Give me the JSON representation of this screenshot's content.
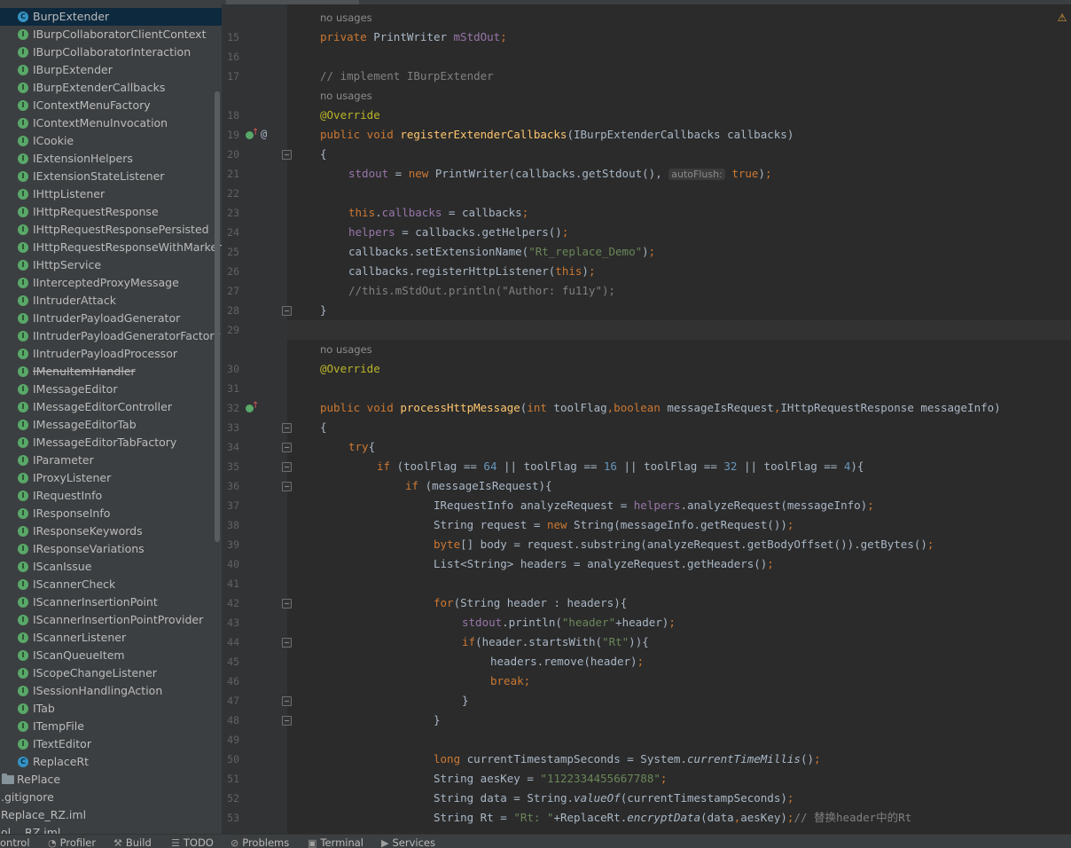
{
  "sidebar": {
    "items": [
      {
        "label": "BurpExtender",
        "kind": "class",
        "selected": true,
        "strike": false
      },
      {
        "label": "IBurpCollaboratorClientContext",
        "kind": "interface"
      },
      {
        "label": "IBurpCollaboratorInteraction",
        "kind": "interface"
      },
      {
        "label": "IBurpExtender",
        "kind": "interface"
      },
      {
        "label": "IBurpExtenderCallbacks",
        "kind": "interface"
      },
      {
        "label": "IContextMenuFactory",
        "kind": "interface"
      },
      {
        "label": "IContextMenuInvocation",
        "kind": "interface"
      },
      {
        "label": "ICookie",
        "kind": "interface"
      },
      {
        "label": "IExtensionHelpers",
        "kind": "interface"
      },
      {
        "label": "IExtensionStateListener",
        "kind": "interface"
      },
      {
        "label": "IHttpListener",
        "kind": "interface"
      },
      {
        "label": "IHttpRequestResponse",
        "kind": "interface"
      },
      {
        "label": "IHttpRequestResponsePersisted",
        "kind": "interface"
      },
      {
        "label": "IHttpRequestResponseWithMarkers",
        "kind": "interface"
      },
      {
        "label": "IHttpService",
        "kind": "interface"
      },
      {
        "label": "IInterceptedProxyMessage",
        "kind": "interface"
      },
      {
        "label": "IIntruderAttack",
        "kind": "interface"
      },
      {
        "label": "IIntruderPayloadGenerator",
        "kind": "interface"
      },
      {
        "label": "IIntruderPayloadGeneratorFactory",
        "kind": "interface"
      },
      {
        "label": "IIntruderPayloadProcessor",
        "kind": "interface"
      },
      {
        "label": "IMenuItemHandler",
        "kind": "interface",
        "strike": true
      },
      {
        "label": "IMessageEditor",
        "kind": "interface"
      },
      {
        "label": "IMessageEditorController",
        "kind": "interface"
      },
      {
        "label": "IMessageEditorTab",
        "kind": "interface"
      },
      {
        "label": "IMessageEditorTabFactory",
        "kind": "interface"
      },
      {
        "label": "IParameter",
        "kind": "interface"
      },
      {
        "label": "IProxyListener",
        "kind": "interface"
      },
      {
        "label": "IRequestInfo",
        "kind": "interface"
      },
      {
        "label": "IResponseInfo",
        "kind": "interface"
      },
      {
        "label": "IResponseKeywords",
        "kind": "interface"
      },
      {
        "label": "IResponseVariations",
        "kind": "interface"
      },
      {
        "label": "IScanIssue",
        "kind": "interface"
      },
      {
        "label": "IScannerCheck",
        "kind": "interface"
      },
      {
        "label": "IScannerInsertionPoint",
        "kind": "interface"
      },
      {
        "label": "IScannerInsertionPointProvider",
        "kind": "interface"
      },
      {
        "label": "IScannerListener",
        "kind": "interface"
      },
      {
        "label": "IScanQueueItem",
        "kind": "interface"
      },
      {
        "label": "IScopeChangeListener",
        "kind": "interface"
      },
      {
        "label": "ISessionHandlingAction",
        "kind": "interface"
      },
      {
        "label": "ITab",
        "kind": "interface"
      },
      {
        "label": "ITempFile",
        "kind": "interface"
      },
      {
        "label": "ITextEditor",
        "kind": "interface"
      },
      {
        "label": "ReplaceRt",
        "kind": "class"
      },
      {
        "label": "RePlace",
        "kind": "folder"
      },
      {
        "label": ".gitignore",
        "kind": "file"
      },
      {
        "label": "Replace_RZ.iml",
        "kind": "file"
      },
      {
        "label": "ol... RZ.iml",
        "kind": "file"
      }
    ]
  },
  "editor": {
    "no_usages_label": "no usages",
    "lines": [
      {
        "type": "nousage"
      },
      {
        "n": "15",
        "indent": 0,
        "parts": [
          [
            "kw",
            "private "
          ],
          [
            "",
            "PrintWriter "
          ],
          [
            "fld",
            "mStdOut"
          ],
          [
            "kw",
            ";"
          ]
        ]
      },
      {
        "n": "16",
        "indent": 0,
        "parts": []
      },
      {
        "n": "17",
        "indent": 0,
        "parts": [
          [
            "cmt",
            "// implement IBurpExtender"
          ]
        ]
      },
      {
        "type": "nousage"
      },
      {
        "n": "18",
        "indent": 0,
        "parts": [
          [
            "ann",
            "@Override"
          ]
        ]
      },
      {
        "n": "19",
        "indent": 0,
        "gutter": "impl-at",
        "parts": [
          [
            "kw",
            "public void "
          ],
          [
            "fn",
            "registerExtenderCallbacks"
          ],
          [
            "",
            "(IBurpExtenderCallbacks callbacks)"
          ]
        ]
      },
      {
        "n": "20",
        "indent": 0,
        "fold": true,
        "parts": [
          [
            "",
            "{"
          ]
        ]
      },
      {
        "n": "21",
        "indent": 1,
        "parts": [
          [
            "fld",
            "stdout"
          ],
          [
            "",
            " = "
          ],
          [
            "kw",
            "new "
          ],
          [
            "",
            "PrintWriter(callbacks.getStdout(), "
          ],
          [
            "hint",
            "autoFlush:"
          ],
          [
            "",
            " "
          ],
          [
            "kw",
            "true"
          ],
          [
            "",
            ")"
          ],
          [
            "kw",
            ";"
          ]
        ]
      },
      {
        "n": "22",
        "indent": 0,
        "parts": []
      },
      {
        "n": "23",
        "indent": 1,
        "parts": [
          [
            "kw",
            "this"
          ],
          [
            "",
            "."
          ],
          [
            "fld",
            "callbacks"
          ],
          [
            "",
            " = callbacks"
          ],
          [
            "kw",
            ";"
          ]
        ]
      },
      {
        "n": "24",
        "indent": 1,
        "parts": [
          [
            "fld",
            "helpers"
          ],
          [
            "",
            " = callbacks.getHelpers()"
          ],
          [
            "kw",
            ";"
          ]
        ]
      },
      {
        "n": "25",
        "indent": 1,
        "parts": [
          [
            "",
            "callbacks.setExtensionName("
          ],
          [
            "str",
            "\"Rt_replace_Demo\""
          ],
          [
            "",
            ")"
          ],
          [
            "kw",
            ";"
          ]
        ]
      },
      {
        "n": "26",
        "indent": 1,
        "parts": [
          [
            "",
            "callbacks.registerHttpListener("
          ],
          [
            "kw",
            "this"
          ],
          [
            "",
            ")"
          ],
          [
            "kw",
            ";"
          ]
        ]
      },
      {
        "n": "27",
        "indent": 1,
        "parts": [
          [
            "cmt",
            "//this.mStdOut.println(\"Author: fu11y\");"
          ]
        ]
      },
      {
        "n": "28",
        "indent": 0,
        "fold": true,
        "parts": [
          [
            "",
            "}"
          ]
        ]
      },
      {
        "n": "29",
        "indent": 0,
        "current": true,
        "parts": []
      },
      {
        "type": "nousage"
      },
      {
        "n": "30",
        "indent": 0,
        "parts": [
          [
            "ann",
            "@Override"
          ]
        ]
      },
      {
        "n": "31",
        "indent": 0,
        "parts": []
      },
      {
        "n": "32",
        "indent": 0,
        "gutter": "impl",
        "parts": [
          [
            "kw",
            "public void "
          ],
          [
            "fn",
            "processHttpMessage"
          ],
          [
            "",
            "("
          ],
          [
            "kw",
            "int "
          ],
          [
            "",
            "toolFlag"
          ],
          [
            "kw",
            ","
          ],
          [
            "kw",
            "boolean "
          ],
          [
            "",
            "messageIsRequest"
          ],
          [
            "kw",
            ","
          ],
          [
            "",
            "IHttpRequestResponse messageInfo)"
          ]
        ]
      },
      {
        "n": "33",
        "indent": 0,
        "fold": true,
        "parts": [
          [
            "",
            "{"
          ]
        ]
      },
      {
        "n": "34",
        "indent": 1,
        "fold": true,
        "parts": [
          [
            "kw",
            "try"
          ],
          [
            "",
            "{"
          ]
        ]
      },
      {
        "n": "35",
        "indent": 2,
        "fold": true,
        "parts": [
          [
            "kw",
            "if "
          ],
          [
            "",
            "(toolFlag == "
          ],
          [
            "num",
            "64"
          ],
          [
            "",
            " || toolFlag == "
          ],
          [
            "num",
            "16"
          ],
          [
            "",
            " || toolFlag == "
          ],
          [
            "num",
            "32"
          ],
          [
            "",
            " || toolFlag == "
          ],
          [
            "num",
            "4"
          ],
          [
            "",
            "){"
          ]
        ]
      },
      {
        "n": "36",
        "indent": 3,
        "fold": true,
        "parts": [
          [
            "kw",
            "if "
          ],
          [
            "",
            "(messageIsRequest){"
          ]
        ]
      },
      {
        "n": "37",
        "indent": 4,
        "parts": [
          [
            "",
            "IRequestInfo analyzeRequest = "
          ],
          [
            "fld",
            "helpers"
          ],
          [
            "",
            ".analyzeRequest(messageInfo)"
          ],
          [
            "kw",
            ";"
          ]
        ]
      },
      {
        "n": "38",
        "indent": 4,
        "parts": [
          [
            "",
            "String request = "
          ],
          [
            "kw",
            "new "
          ],
          [
            "",
            "String(messageInfo.getRequest())"
          ],
          [
            "kw",
            ";"
          ]
        ]
      },
      {
        "n": "39",
        "indent": 4,
        "parts": [
          [
            "kw",
            "byte"
          ],
          [
            "",
            "[] body = request.substring(analyzeRequest.getBodyOffset()).getBytes()"
          ],
          [
            "kw",
            ";"
          ]
        ]
      },
      {
        "n": "40",
        "indent": 4,
        "parts": [
          [
            "",
            "List<String> headers = analyzeRequest.getHeaders()"
          ],
          [
            "kw",
            ";"
          ]
        ]
      },
      {
        "n": "41",
        "indent": 0,
        "parts": []
      },
      {
        "n": "42",
        "indent": 4,
        "fold": true,
        "parts": [
          [
            "kw",
            "for"
          ],
          [
            "",
            "(String header : headers){"
          ]
        ]
      },
      {
        "n": "43",
        "indent": 5,
        "parts": [
          [
            "fld",
            "stdout"
          ],
          [
            "",
            ".println("
          ],
          [
            "str",
            "\"header\""
          ],
          [
            "",
            "+header)"
          ],
          [
            "kw",
            ";"
          ]
        ]
      },
      {
        "n": "44",
        "indent": 5,
        "fold": true,
        "parts": [
          [
            "kw",
            "if"
          ],
          [
            "",
            "(header.startsWith("
          ],
          [
            "str",
            "\"Rt\""
          ],
          [
            "",
            "))"
          ],
          [
            "",
            "{"
          ]
        ]
      },
      {
        "n": "45",
        "indent": 6,
        "parts": [
          [
            "",
            "headers.remove(header)"
          ],
          [
            "kw",
            ";"
          ]
        ]
      },
      {
        "n": "46",
        "indent": 6,
        "parts": [
          [
            "kw",
            "break;"
          ]
        ]
      },
      {
        "n": "47",
        "indent": 5,
        "fold": true,
        "parts": [
          [
            "",
            "}"
          ]
        ]
      },
      {
        "n": "48",
        "indent": 4,
        "fold": true,
        "parts": [
          [
            "",
            "}"
          ]
        ]
      },
      {
        "n": "49",
        "indent": 0,
        "parts": []
      },
      {
        "n": "50",
        "indent": 4,
        "parts": [
          [
            "kw",
            "long "
          ],
          [
            "",
            "currentTimestampSeconds = System."
          ],
          [
            "it",
            "currentTimeMillis"
          ],
          [
            "",
            "()"
          ],
          [
            "kw",
            ";"
          ]
        ]
      },
      {
        "n": "51",
        "indent": 4,
        "parts": [
          [
            "",
            "String aesKey = "
          ],
          [
            "str",
            "\"1122334455667788\""
          ],
          [
            "kw",
            ";"
          ]
        ]
      },
      {
        "n": "52",
        "indent": 4,
        "parts": [
          [
            "",
            "String data = String."
          ],
          [
            "it",
            "valueOf"
          ],
          [
            "",
            "(currentTimestampSeconds)"
          ],
          [
            "kw",
            ";"
          ]
        ]
      },
      {
        "n": "53",
        "indent": 4,
        "parts": [
          [
            "",
            "String Rt = "
          ],
          [
            "str",
            "\"Rt: \""
          ],
          [
            "",
            "+ReplaceRt."
          ],
          [
            "it",
            "encryptData"
          ],
          [
            "",
            "(data"
          ],
          [
            "kw",
            ","
          ],
          [
            "",
            "aesKey)"
          ],
          [
            "kw",
            ";"
          ],
          [
            "cmt",
            "// 替换header中的Rt"
          ]
        ]
      }
    ]
  },
  "bottom_bar": {
    "tabs": [
      {
        "label": "ontrol",
        "icon": ""
      },
      {
        "label": "Profiler",
        "icon": "profiler-icon"
      },
      {
        "label": "Build",
        "icon": "build-icon"
      },
      {
        "label": "TODO",
        "icon": "todo-icon"
      },
      {
        "label": "Problems",
        "icon": "problems-icon"
      },
      {
        "label": "Terminal",
        "icon": "terminal-icon"
      },
      {
        "label": "Services",
        "icon": "services-icon"
      }
    ]
  },
  "colors": {
    "keyword": "#cc7832",
    "function": "#ffc66d",
    "string": "#6a8759",
    "comment": "#808080",
    "annotation": "#bbb529",
    "field": "#9876aa",
    "number": "#6897bb",
    "text": "#a9b7c6",
    "interface_icon": "#59a869",
    "class_icon": "#3592c4",
    "selection": "#0d293e"
  }
}
